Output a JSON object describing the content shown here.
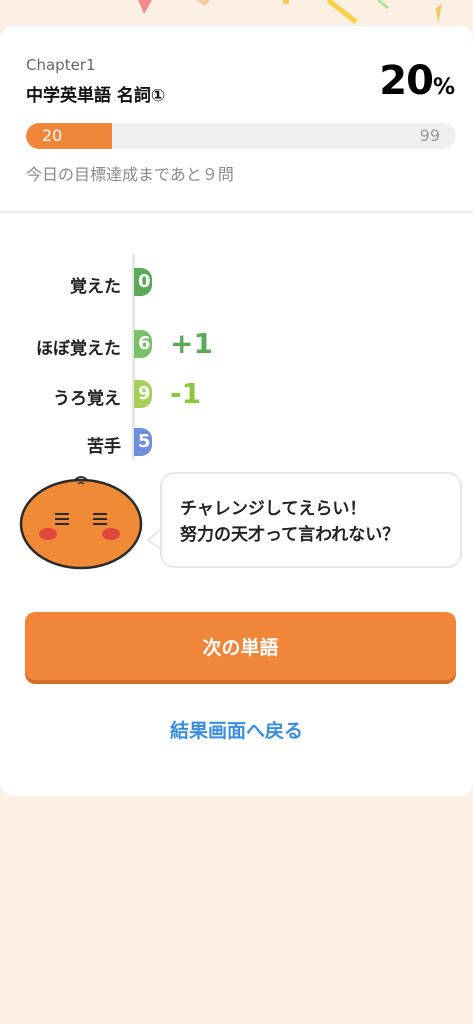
{
  "header": {
    "chapter": "Chapter1",
    "title": "中学英単語 名詞①",
    "percent_value": "20",
    "percent_symbol": "%",
    "progress_current": "20",
    "progress_max": "99",
    "progress_fraction": 0.2,
    "remaining_text": "今日の目標達成まであと９問"
  },
  "stats": [
    {
      "label": "覚えた",
      "value": "0",
      "delta": "",
      "color": "#5BAA57"
    },
    {
      "label": "ほぼ覚えた",
      "value": "6",
      "delta": "+1",
      "color": "#79C06B",
      "delta_color": "#5BAA57"
    },
    {
      "label": "うろ覚え",
      "value": "9",
      "delta": "-1",
      "color": "#A6D05A",
      "delta_color": "#8CC63F"
    },
    {
      "label": "苦手",
      "value": "5",
      "delta": "",
      "color": "#6E8FDB"
    }
  ],
  "message": {
    "line1": "チャレンジしてえらい！",
    "line2": "努力の天才って言われない？"
  },
  "buttons": {
    "next": "次の単語",
    "back": "結果画面へ戻る"
  },
  "colors": {
    "accent": "#F0863A",
    "link": "#3A8DDE",
    "background": "#FCEFE4"
  }
}
